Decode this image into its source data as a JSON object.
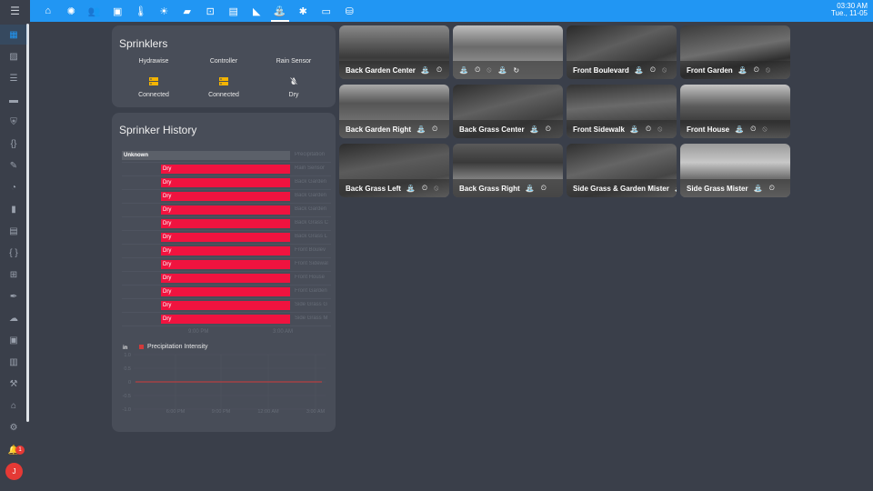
{
  "topbar": {
    "menu_icon": "menu-icon",
    "tabs": [
      {
        "icon": "home-icon",
        "glyph": "⌂"
      },
      {
        "icon": "lightbulb-icon",
        "glyph": "✺"
      },
      {
        "icon": "people-icon",
        "glyph": "👥"
      },
      {
        "icon": "calendar-icon",
        "glyph": "▣"
      },
      {
        "icon": "thermometer-icon",
        "glyph": "🌡"
      },
      {
        "icon": "weather-icon",
        "glyph": "☀"
      },
      {
        "icon": "garage-icon",
        "glyph": "▰"
      },
      {
        "icon": "safe-icon",
        "glyph": "⊡"
      },
      {
        "icon": "gallery-icon",
        "glyph": "▤"
      },
      {
        "icon": "camera-icon",
        "glyph": "◣"
      },
      {
        "icon": "sprinkler-icon",
        "glyph": "⛲"
      },
      {
        "icon": "bug-icon",
        "glyph": "✱"
      },
      {
        "icon": "laptop-icon",
        "glyph": "▭"
      },
      {
        "icon": "database-icon",
        "glyph": "⛁"
      }
    ],
    "active_tab": 10,
    "time": "03:30 AM",
    "date": "Tue., 11-05"
  },
  "sidebar": {
    "items": [
      {
        "icon": "dashboard-icon",
        "glyph": "▦"
      },
      {
        "icon": "inbox-icon",
        "glyph": "▨"
      },
      {
        "icon": "list-icon",
        "glyph": "☰"
      },
      {
        "icon": "id-card-icon",
        "glyph": "▬"
      },
      {
        "icon": "shield-icon",
        "glyph": "⛨"
      },
      {
        "icon": "braces-icon",
        "glyph": "{}"
      },
      {
        "icon": "wrench-icon",
        "glyph": "✎"
      },
      {
        "icon": "gauge-icon",
        "glyph": "◔"
      },
      {
        "icon": "book-icon",
        "glyph": "▮"
      },
      {
        "icon": "file-icon",
        "glyph": "▤"
      },
      {
        "icon": "code-icon",
        "glyph": "{ }"
      },
      {
        "icon": "network-icon",
        "glyph": "⊞"
      },
      {
        "icon": "paint-icon",
        "glyph": "✒"
      },
      {
        "icon": "cloud-icon",
        "glyph": "☁"
      },
      {
        "icon": "terminal-icon",
        "glyph": "▣"
      },
      {
        "icon": "chart-icon",
        "glyph": "▥"
      },
      {
        "icon": "hammer-icon",
        "glyph": "⚒"
      },
      {
        "icon": "home-assistant-icon",
        "glyph": "⌂"
      },
      {
        "icon": "settings-icon",
        "glyph": "⚙"
      }
    ],
    "notification_count": "1",
    "notification_icon": "bell-icon",
    "user_initial": "J"
  },
  "sprinklers": {
    "title": "Sprinklers",
    "columns": [
      {
        "label": "Hydrawise",
        "state": "Connected",
        "icon": "server-icon"
      },
      {
        "label": "Controller",
        "state": "Connected",
        "icon": "server-icon"
      },
      {
        "label": "Rain Sensor",
        "state": "Dry",
        "icon": "water-off-icon"
      }
    ]
  },
  "history": {
    "title": "Sprinker History",
    "rows": [
      {
        "state": "Unknown",
        "entity": "Precipitation"
      },
      {
        "state": "Dry",
        "entity": "Rain Sensor"
      },
      {
        "state": "Dry",
        "entity": "Back Garden"
      },
      {
        "state": "Dry",
        "entity": "Back Garden"
      },
      {
        "state": "Dry",
        "entity": "Back Garden"
      },
      {
        "state": "Dry",
        "entity": "Back Grass C"
      },
      {
        "state": "Dry",
        "entity": "Back Grass L"
      },
      {
        "state": "Dry",
        "entity": "Front Boulev"
      },
      {
        "state": "Dry",
        "entity": "Front Sidewal"
      },
      {
        "state": "Dry",
        "entity": "Front House"
      },
      {
        "state": "Dry",
        "entity": "Front Garden"
      },
      {
        "state": "Dry",
        "entity": "Side Grass G"
      },
      {
        "state": "Dry",
        "entity": "Side Grass M"
      }
    ],
    "timeline_ticks": [
      "9:00 PM",
      "3:00 AM"
    ],
    "precip": {
      "unit": "in",
      "legend": "Precipitation Intensity",
      "color": "#d23a3a",
      "y_ticks": [
        "1.0",
        "0.5",
        "0",
        "-0.5",
        "-1.0"
      ],
      "x_ticks": [
        "6:00 PM",
        "9:00 PM",
        "12:00 AM",
        "3:00 AM"
      ]
    }
  },
  "cameras": [
    {
      "name": "Back Garden Center",
      "icons": [
        "sprinkler-icon",
        "calendar-clock-icon"
      ],
      "glyphs": [
        "⛲",
        "⏲"
      ]
    },
    {
      "name": "",
      "icons": [
        "sprinkler-icon",
        "calendar-clock-icon",
        "water-off-icon",
        "sprinkler-icon",
        "refresh-icon"
      ],
      "glyphs": [
        "⛲",
        "⏲",
        "⦸",
        "⛲",
        "↻"
      ]
    },
    {
      "name": "Front Boulevard",
      "icons": [
        "sprinkler-icon",
        "calendar-clock-icon",
        "water-off-icon"
      ],
      "glyphs": [
        "⛲",
        "⏲",
        "⦸"
      ]
    },
    {
      "name": "Front Garden",
      "icons": [
        "sprinkler-icon",
        "calendar-clock-icon",
        "water-off-icon"
      ],
      "glyphs": [
        "⛲",
        "⏲",
        "⦸"
      ]
    },
    {
      "name": "Back Garden Right",
      "icons": [
        "sprinkler-icon",
        "calendar-clock-icon"
      ],
      "glyphs": [
        "⛲",
        "⏲"
      ]
    },
    {
      "name": "Back Grass Center",
      "icons": [
        "sprinkler-icon",
        "calendar-clock-icon"
      ],
      "glyphs": [
        "⛲",
        "⏲"
      ]
    },
    {
      "name": "Front Sidewalk",
      "icons": [
        "sprinkler-icon",
        "calendar-clock-icon",
        "water-off-icon"
      ],
      "glyphs": [
        "⛲",
        "⏲",
        "⦸"
      ]
    },
    {
      "name": "Front House",
      "icons": [
        "sprinkler-icon",
        "calendar-clock-icon",
        "water-off-icon"
      ],
      "glyphs": [
        "⛲",
        "⏲",
        "⦸"
      ]
    },
    {
      "name": "Back Grass Left",
      "icons": [
        "sprinkler-icon",
        "calendar-clock-icon",
        "water-off-icon"
      ],
      "glyphs": [
        "⛲",
        "⏲",
        "⦸"
      ]
    },
    {
      "name": "Back Grass Right",
      "icons": [
        "sprinkler-icon",
        "calendar-clock-icon"
      ],
      "glyphs": [
        "⛲",
        "⏲"
      ]
    },
    {
      "name": "Side Grass & Garden Mister",
      "icons": [
        "sprinkler-icon"
      ],
      "glyphs": [
        "⛲"
      ]
    },
    {
      "name": "Side Grass Mister",
      "icons": [
        "sprinkler-icon",
        "calendar-clock-icon"
      ],
      "glyphs": [
        "⛲",
        "⏲"
      ]
    }
  ]
}
